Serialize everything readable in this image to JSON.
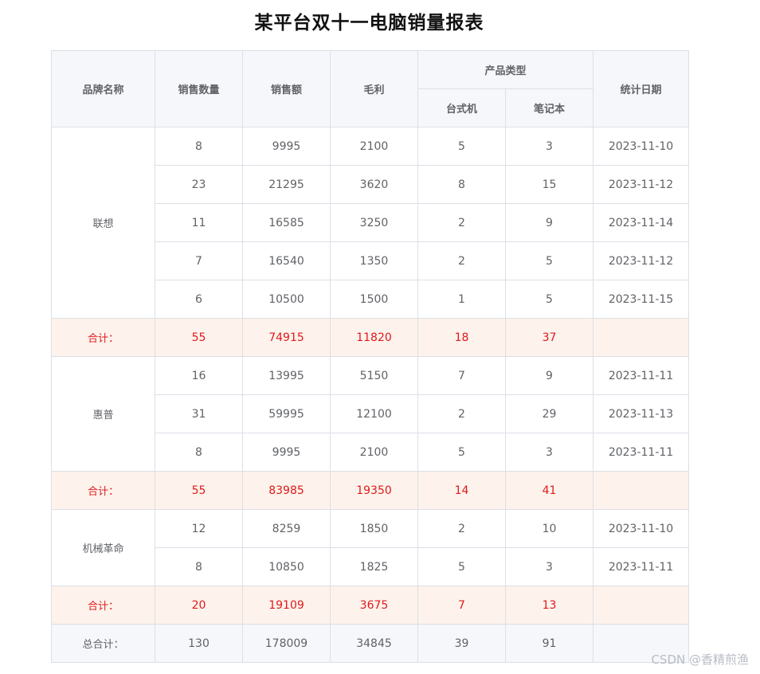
{
  "title": "某平台双十一电脑销量报表",
  "headers": {
    "brand": "品牌名称",
    "qty": "销售数量",
    "amount": "销售额",
    "profit": "毛利",
    "product_type": "产品类型",
    "desktop": "台式机",
    "laptop": "笔记本",
    "date": "统计日期"
  },
  "groups": [
    {
      "brand": "联想",
      "rows": [
        {
          "qty": "8",
          "amount": "9995",
          "profit": "2100",
          "desktop": "5",
          "laptop": "3",
          "date": "2023-11-10"
        },
        {
          "qty": "23",
          "amount": "21295",
          "profit": "3620",
          "desktop": "8",
          "laptop": "15",
          "date": "2023-11-12"
        },
        {
          "qty": "11",
          "amount": "16585",
          "profit": "3250",
          "desktop": "2",
          "laptop": "9",
          "date": "2023-11-14"
        },
        {
          "qty": "7",
          "amount": "16540",
          "profit": "1350",
          "desktop": "2",
          "laptop": "5",
          "date": "2023-11-12"
        },
        {
          "qty": "6",
          "amount": "10500",
          "profit": "1500",
          "desktop": "1",
          "laptop": "5",
          "date": "2023-11-15"
        }
      ],
      "subtotal": {
        "label": "合计：",
        "qty": "55",
        "amount": "74915",
        "profit": "11820",
        "desktop": "18",
        "laptop": "37",
        "date": ""
      }
    },
    {
      "brand": "惠普",
      "rows": [
        {
          "qty": "16",
          "amount": "13995",
          "profit": "5150",
          "desktop": "7",
          "laptop": "9",
          "date": "2023-11-11"
        },
        {
          "qty": "31",
          "amount": "59995",
          "profit": "12100",
          "desktop": "2",
          "laptop": "29",
          "date": "2023-11-13"
        },
        {
          "qty": "8",
          "amount": "9995",
          "profit": "2100",
          "desktop": "5",
          "laptop": "3",
          "date": "2023-11-11"
        }
      ],
      "subtotal": {
        "label": "合计：",
        "qty": "55",
        "amount": "83985",
        "profit": "19350",
        "desktop": "14",
        "laptop": "41",
        "date": ""
      }
    },
    {
      "brand": "机械革命",
      "rows": [
        {
          "qty": "12",
          "amount": "8259",
          "profit": "1850",
          "desktop": "2",
          "laptop": "10",
          "date": "2023-11-10"
        },
        {
          "qty": "8",
          "amount": "10850",
          "profit": "1825",
          "desktop": "5",
          "laptop": "3",
          "date": "2023-11-11"
        }
      ],
      "subtotal": {
        "label": "合计：",
        "qty": "20",
        "amount": "19109",
        "profit": "3675",
        "desktop": "7",
        "laptop": "13",
        "date": ""
      }
    }
  ],
  "grand_total": {
    "label": "总合计：",
    "qty": "130",
    "amount": "178009",
    "profit": "34845",
    "desktop": "39",
    "laptop": "91",
    "date": ""
  },
  "watermark": "CSDN @香精煎渔",
  "colors": {
    "header_bg": "#f5f7fa",
    "subtotal_bg": "#fdf3ec",
    "subtotal_text": "#e0191c",
    "border": "#dcdfe6",
    "text": "#606266"
  }
}
